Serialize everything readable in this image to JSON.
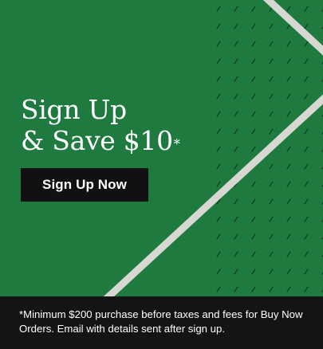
{
  "promo": {
    "headline_line1": "Sign Up",
    "headline_line2": "& Save $10",
    "headline_asterisk": "*",
    "cta_label": "Sign Up Now",
    "disclaimer": "*Minimum $200 purchase before taxes and fees for Buy Now Orders. Email with details sent after sign up."
  },
  "colors": {
    "background_green": "#1f7a40",
    "court_line": "#d7d8d2",
    "button_bg": "#111111",
    "footer_bg": "#141414",
    "text": "#ffffff"
  }
}
